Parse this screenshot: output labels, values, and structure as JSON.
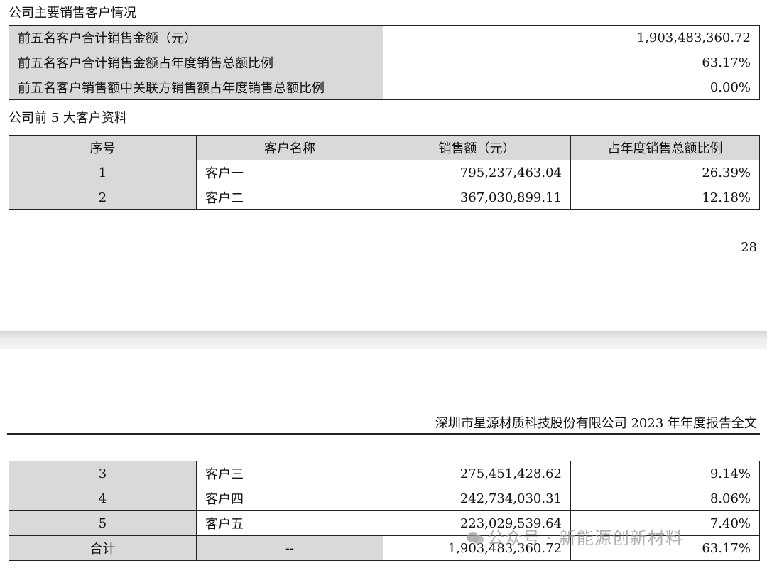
{
  "section_title": "公司主要销售客户情况",
  "summary_rows": [
    {
      "label": "前五名客户合计销售金额（元）",
      "value": "1,903,483,360.72"
    },
    {
      "label": "前五名客户合计销售金额占年度销售总额比例",
      "value": "63.17%"
    },
    {
      "label": "前五名客户销售额中关联方销售额占年度销售总额比例",
      "value": "0.00%"
    }
  ],
  "top5_title": "公司前 5 大客户资料",
  "table_headers": [
    "序号",
    "客户名称",
    "销售额（元）",
    "占年度销售总额比例"
  ],
  "rows_page1": [
    {
      "no": "1",
      "name": "客户一",
      "amount": "795,237,463.04",
      "pct": "26.39%"
    },
    {
      "no": "2",
      "name": "客户二",
      "amount": "367,030,899.11",
      "pct": "12.18%"
    }
  ],
  "page_number": "28",
  "report_header": "深圳市星源材质科技股份有限公司 2023 年年度报告全文",
  "rows_page2": [
    {
      "no": "3",
      "name": "客户三",
      "amount": "275,451,428.62",
      "pct": "9.14%"
    },
    {
      "no": "4",
      "name": "客户四",
      "amount": "242,734,030.31",
      "pct": "8.06%"
    },
    {
      "no": "5",
      "name": "客户五",
      "amount": "223,029,539.64",
      "pct": "7.40%"
    }
  ],
  "total_row": {
    "no": "合计",
    "name": "--",
    "amount": "1,903,483,360.72",
    "pct": "63.17%"
  },
  "watermark": "公众号 · 新能源创新材料",
  "colors": {
    "header_gray": "#d9d9d9",
    "border": "#222222",
    "page_gap": "#e0e0e0"
  }
}
